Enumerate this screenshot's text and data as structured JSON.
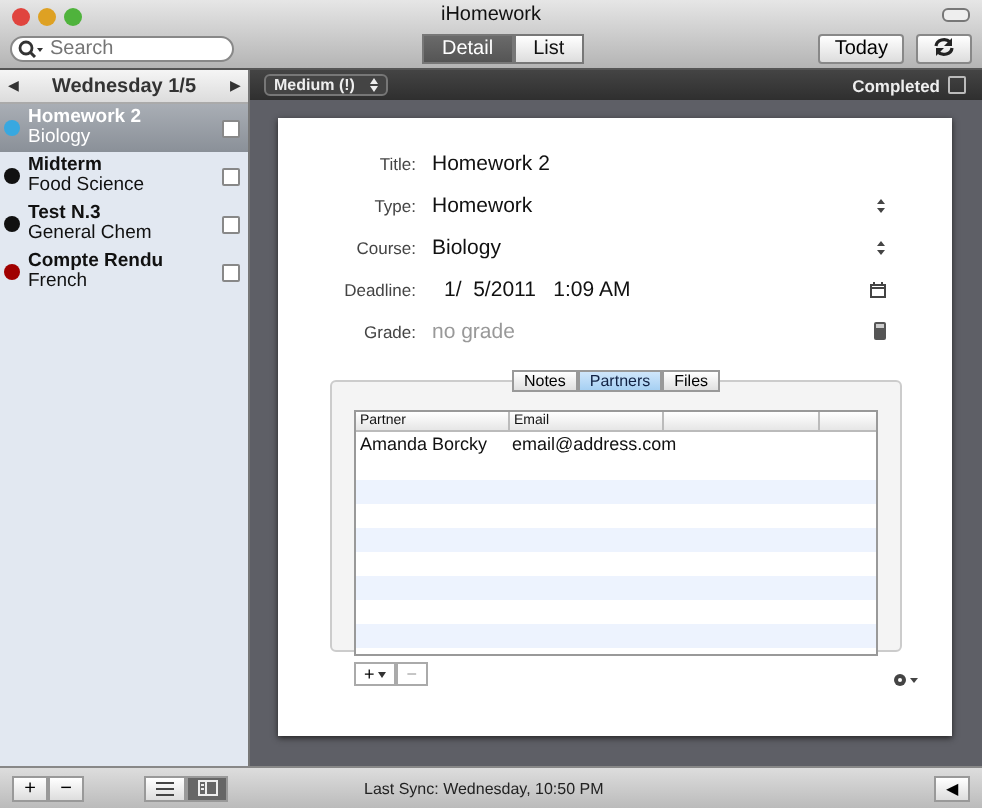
{
  "window": {
    "title": "iHomework"
  },
  "search": {
    "placeholder": "Search"
  },
  "view_tabs": [
    {
      "label": "Detail",
      "selected": true
    },
    {
      "label": "List",
      "selected": false
    }
  ],
  "today_button": "Today",
  "date_nav": {
    "prev": "◀",
    "label": "Wednesday 1/5",
    "next": "▶"
  },
  "assignments": [
    {
      "title": "Homework 2",
      "course": "Biology",
      "color": "#38a8e0",
      "selected": true,
      "checked": false
    },
    {
      "title": "Midterm",
      "course": "Food Science",
      "color": "#111111",
      "selected": false,
      "checked": false
    },
    {
      "title": "Test N.3",
      "course": "General Chem",
      "color": "#111111",
      "selected": false,
      "checked": false
    },
    {
      "title": "Compte Rendu",
      "course": "French",
      "color": "#a00000",
      "selected": false,
      "checked": false
    }
  ],
  "detail": {
    "priority": "Medium (!)",
    "completed": {
      "label": "Completed",
      "checked": false
    },
    "fields": [
      {
        "label": "Title:",
        "value": "Homework 2",
        "kind": "text"
      },
      {
        "label": "Type:",
        "value": "Homework",
        "kind": "popup"
      },
      {
        "label": "Course:",
        "value": "Biology",
        "kind": "popup"
      },
      {
        "label": "Deadline:",
        "value": "1/  5/2011   1:09 AM",
        "kind": "date"
      },
      {
        "label": "Grade:",
        "placeholder": "no grade",
        "kind": "grade"
      }
    ],
    "tabs": [
      {
        "label": "Notes",
        "selected": false
      },
      {
        "label": "Partners",
        "selected": true
      },
      {
        "label": "Files",
        "selected": false
      }
    ],
    "table": {
      "columns": [
        "Partner",
        "Email"
      ],
      "rows": [
        [
          "Amanda Borcky",
          "email@address.com"
        ]
      ]
    },
    "add_button": "+",
    "remove_button": "−"
  },
  "bottom_bar": {
    "add": "+",
    "remove": "−",
    "views": [
      {
        "kind": "list",
        "selected": false
      },
      {
        "kind": "detail",
        "selected": true
      }
    ],
    "status": "Last Sync: Wednesday, 10:50 PM",
    "collapse": "◀"
  }
}
